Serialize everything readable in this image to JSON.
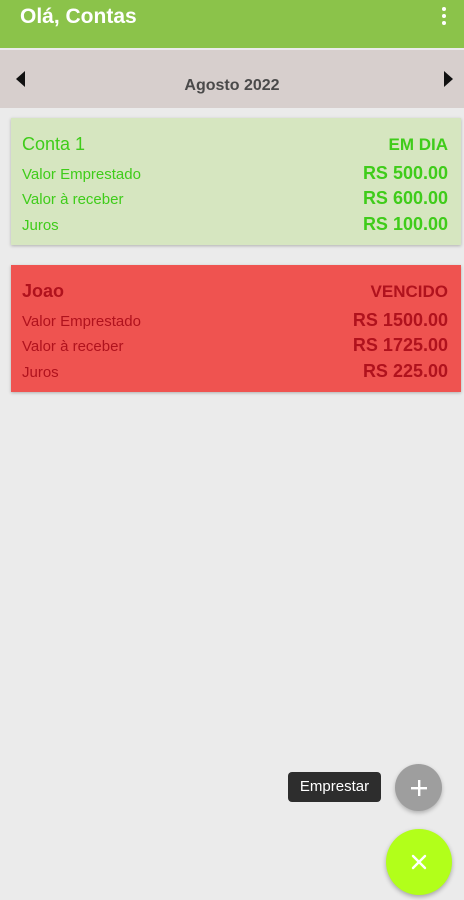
{
  "appbar": {
    "title": "Olá, Contas",
    "menu_icon": "more-vert-icon"
  },
  "month_nav": {
    "label": "Agosto 2022",
    "prev_icon": "arrow-left-icon",
    "next_icon": "arrow-right-icon"
  },
  "accounts": [
    {
      "name": "Conta 1",
      "status": "EM DIA",
      "loan_label": "Valor Emprestado",
      "loan_value": "RS 500.00",
      "receivable_label": "Valor à receber",
      "receivable_value": "RS 600.00",
      "interest_label": "Juros",
      "interest_value": "RS 100.00",
      "background": "#d6e6c0",
      "text_color": "#3fcc1a"
    },
    {
      "name": "Joao",
      "status": "VENCIDO",
      "loan_label": "Valor Emprestado",
      "loan_value": "RS 1500.00",
      "receivable_label": "Valor à receber",
      "receivable_value": "RS 1725.00",
      "interest_label": "Juros",
      "interest_value": "RS 225.00",
      "background": "#ef5350",
      "text_color": "#b0121d"
    }
  ],
  "fab": {
    "tooltip": "Emprestar",
    "mini_icon": "plus-icon",
    "main_icon": "close-icon",
    "main_color": "#b2ff1a"
  },
  "colors": {
    "appbar": "#8bc34a",
    "month_bar": "#d7cfcd",
    "background": "#ebebeb"
  }
}
